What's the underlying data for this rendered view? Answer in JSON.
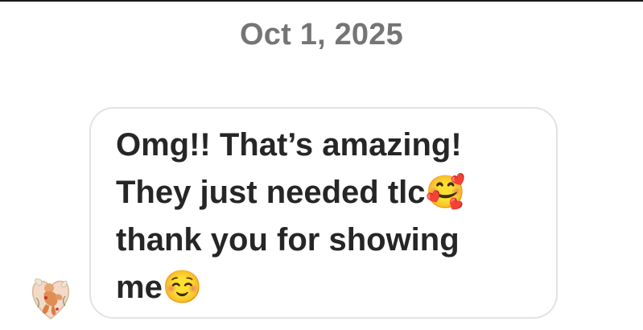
{
  "conversation": {
    "date_header": "Oct 1, 2025"
  },
  "message": {
    "text": "Omg!! That’s amazing!\nThey just needed tlc🥰\nthank you for showing\nme☺️",
    "sender_avatar": "cherub-heart-avatar"
  },
  "colors": {
    "date_text": "#757575",
    "message_text": "#262626",
    "bubble_border": "#e3e3e3",
    "background": "#ffffff"
  }
}
